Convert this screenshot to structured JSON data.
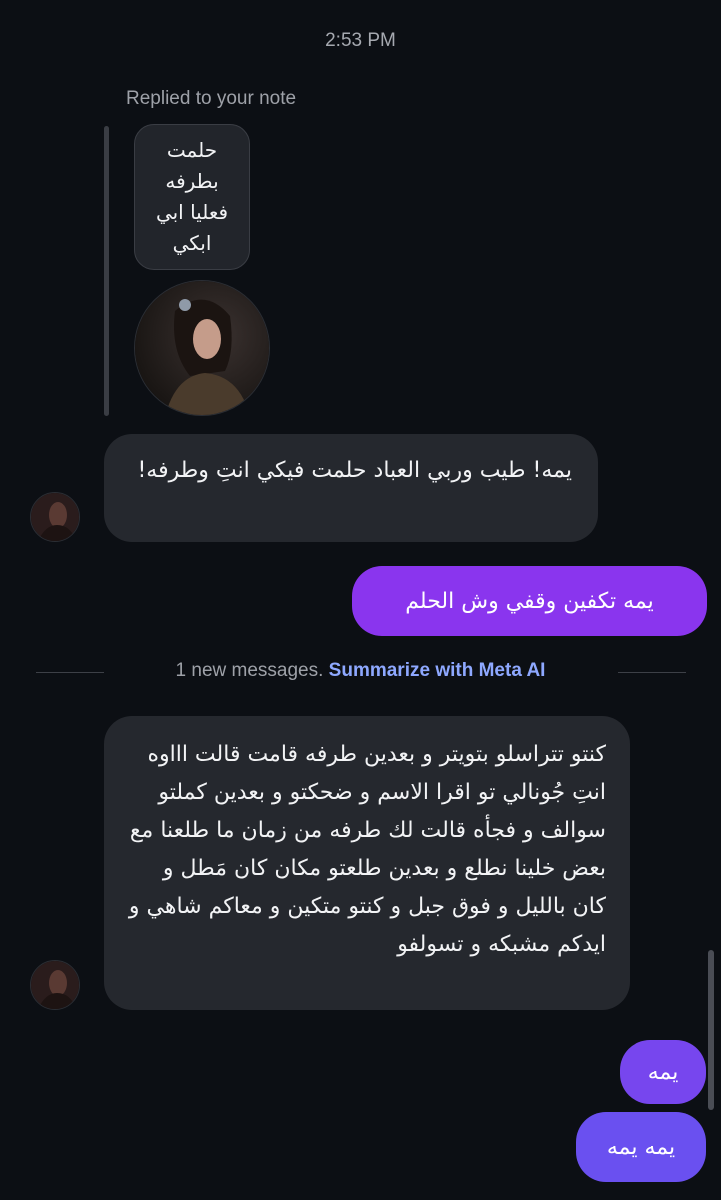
{
  "chat": {
    "timestamp": "2:53 PM",
    "reply_label": "Replied to your note",
    "note_text": "حلمت بطرفه فعليا ابي ابكي",
    "divider": {
      "text": "1 new messages.",
      "link": "Summarize with Meta AI"
    },
    "messages": [
      {
        "sender": "them",
        "text": "يمه! طيب وربي العباد حلمت فيكي انتِ وطرفه!"
      },
      {
        "sender": "me",
        "text": "يمه تكفين وقفي وش الحلم"
      },
      {
        "sender": "them",
        "text": "كنتو تتراسلو بتويتر و بعدين طرفه قامت قالت اااوه انتِ جُونالي تو اقرا الاسم و ضحكتو و بعدين كملتو سوالف و فجأه قالت لك طرفه من زمان ما طلعنا مع بعض خلينا نطلع و بعدين طلعتو مكان كان مَطل و كان بالليل و فوق جبل و كنتو متكين و معاكم شاهي و ايدكم مشبكه و تسولفو"
      },
      {
        "sender": "me",
        "text": "يمه"
      },
      {
        "sender": "me",
        "text": "يمه يمه"
      }
    ],
    "colors": {
      "background": "#0c0f14",
      "incoming_bubble": "#25282e",
      "outgoing_gradient_top": "#8a35ee",
      "outgoing_gradient_bottom": "#6a50f0",
      "link": "#8ea8ff"
    }
  }
}
